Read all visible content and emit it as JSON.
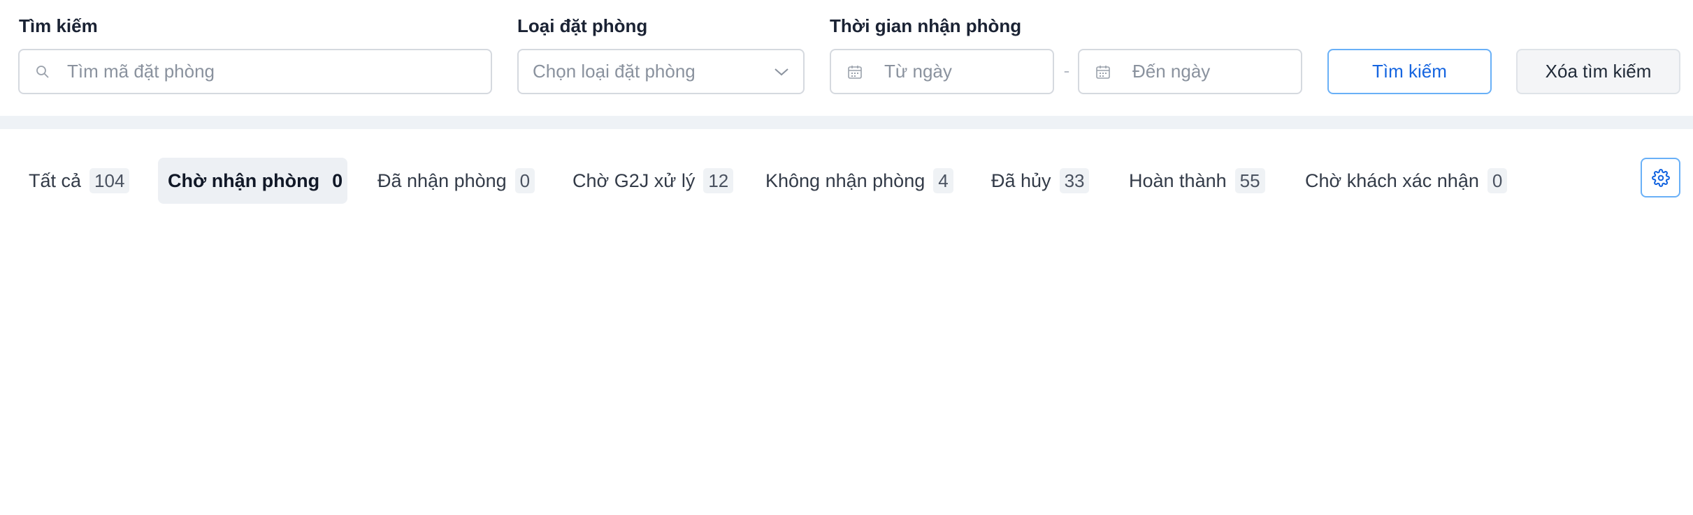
{
  "filters": {
    "search": {
      "label": "Tìm kiếm",
      "placeholder": "Tìm mã đặt phòng",
      "icon": "search-icon"
    },
    "booking_type": {
      "label": "Loại đặt phòng",
      "placeholder": "Chọn loại đặt phòng",
      "icon": "chevron-down-icon"
    },
    "checkin_time": {
      "label": "Thời gian nhận phòng",
      "from_placeholder": "Từ ngày",
      "to_placeholder": "Đến ngày",
      "range_separator": "-",
      "icon": "calendar-icon"
    },
    "search_button": "Tìm kiếm",
    "clear_button": "Xóa tìm kiếm"
  },
  "tabs": [
    {
      "label": "Tất cả",
      "count": "104",
      "active": false
    },
    {
      "label": "Chờ nhận phòng",
      "count": "0",
      "active": true
    },
    {
      "label": "Đã nhận phòng",
      "count": "0",
      "active": false
    },
    {
      "label": "Chờ G2J xử lý",
      "count": "12",
      "active": false
    },
    {
      "label": "Không nhận phòng",
      "count": "4",
      "active": false
    },
    {
      "label": "Đã hủy",
      "count": "33",
      "active": false
    },
    {
      "label": "Hoàn thành",
      "count": "55",
      "active": false
    },
    {
      "label": "Chờ khách xác nhận",
      "count": "0",
      "active": false
    }
  ],
  "settings": {
    "icon": "gear-icon"
  },
  "colors": {
    "accent": "#1565e0",
    "accent_border": "#69b0f7",
    "band": "#eef2f6",
    "active_tab_bg": "#edf0f4"
  }
}
